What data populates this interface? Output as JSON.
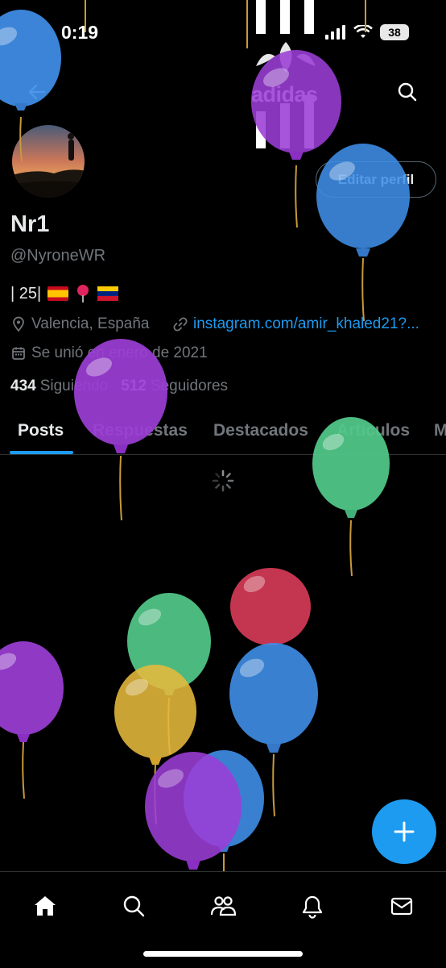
{
  "status_bar": {
    "time": "0:19",
    "battery": "38"
  },
  "banner": {
    "brand": "adidas"
  },
  "profile": {
    "display_name": "Nr1",
    "handle": "@NyroneWR",
    "bio": "| 25|",
    "location": "Valencia, España",
    "link": "instagram.com/amir_khaled21?...",
    "joined": "Se unió en enero de 2021",
    "following_count": "434",
    "following_label": "Siguiendo",
    "followers_count": "512",
    "followers_label": "Seguidores"
  },
  "buttons": {
    "edit_profile": "Editar perfil"
  },
  "tabs": [
    {
      "label": "Posts",
      "active": true
    },
    {
      "label": "Respuestas"
    },
    {
      "label": "Destacados"
    },
    {
      "label": "Artículos"
    },
    {
      "label": "M"
    }
  ],
  "icons": {
    "back": "back-arrow-icon",
    "search": "search-icon",
    "location": "location-pin-icon",
    "link": "link-icon",
    "calendar": "calendar-icon",
    "compose": "plus-icon",
    "nav": [
      "home-icon",
      "explore-icon",
      "communities-icon",
      "notifications-icon",
      "messages-icon"
    ]
  },
  "colors": {
    "accent": "#1d9bf0",
    "background": "#000000",
    "muted": "#71767b"
  }
}
